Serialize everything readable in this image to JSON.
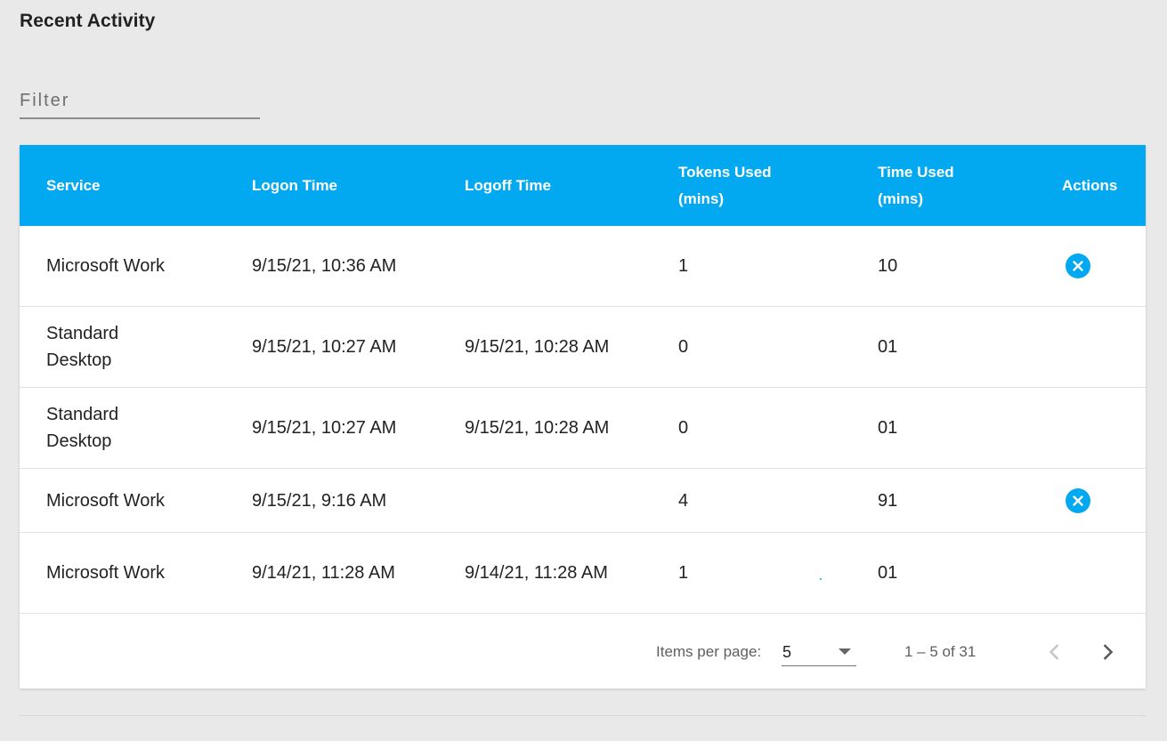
{
  "page": {
    "title": "Recent Activity"
  },
  "filter": {
    "placeholder": "Filter",
    "value": ""
  },
  "table": {
    "columns": {
      "service": "Service",
      "logon": "Logon Time",
      "logoff": "Logoff Time",
      "tokens": "Tokens Used (mins)",
      "time": "Time Used (mins)",
      "actions": "Actions"
    },
    "rows": [
      {
        "service": "Microsoft Work",
        "logon": "9/15/21, 10:36 AM",
        "logoff": "",
        "tokens": "1",
        "time": "10",
        "has_cancel": true
      },
      {
        "service": "Standard Desktop",
        "logon": "9/15/21, 10:27 AM",
        "logoff": "9/15/21, 10:28 AM",
        "tokens": "0",
        "time": "01",
        "has_cancel": false
      },
      {
        "service": "Standard Desktop",
        "logon": "9/15/21, 10:27 AM",
        "logoff": "9/15/21, 10:28 AM",
        "tokens": "0",
        "time": "01",
        "has_cancel": false
      },
      {
        "service": "Microsoft Work",
        "logon": "9/15/21, 9:16 AM",
        "logoff": "",
        "tokens": "4",
        "time": "91",
        "has_cancel": true
      },
      {
        "service": "Microsoft Work",
        "logon": "9/14/21, 11:28 AM",
        "logoff": "9/14/21, 11:28 AM",
        "tokens": "1",
        "time": "01",
        "has_cancel": false
      }
    ]
  },
  "paginator": {
    "items_per_page_label": "Items per page:",
    "items_per_page_value": "5",
    "range_label": "1 – 5 of 31",
    "prev_icon": "chevron-left-icon",
    "next_icon": "chevron-right-icon"
  },
  "colors": {
    "header_bg": "#03a9f0",
    "page_bg": "#e9e9e9",
    "accent": "#03a9f0"
  }
}
